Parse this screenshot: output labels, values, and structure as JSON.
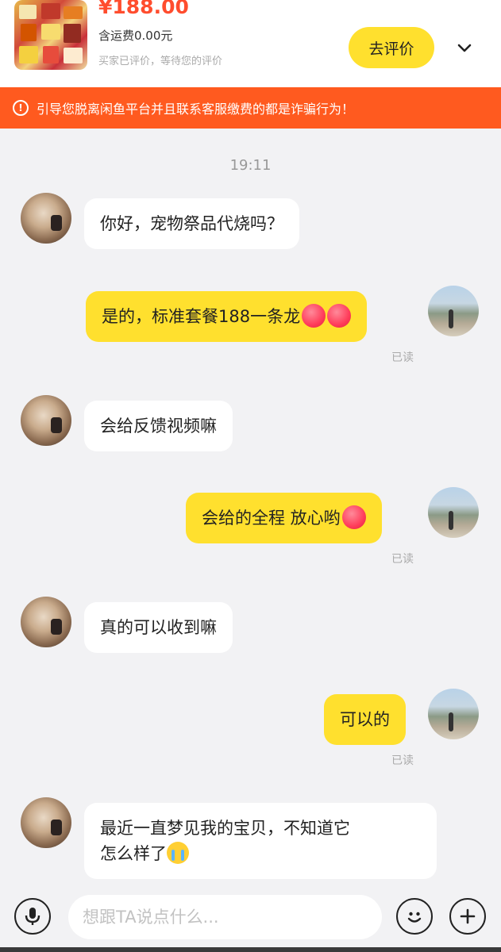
{
  "product": {
    "price": "¥188.00",
    "shipping": "含运费0.00元",
    "review_status": "买家已评价，等待您的评价",
    "review_button": "去评价"
  },
  "warning": {
    "text": "引导您脱离闲鱼平台并且联系客服缴费的都是诈骗行为！"
  },
  "chat": {
    "timestamp": "19:11",
    "messages": [
      {
        "from": "other",
        "text": "你好，宠物祭品代烧吗？"
      },
      {
        "from": "me",
        "text": "是的，标准套餐188一条龙",
        "emoji": "heart-emoji x2",
        "status": "已读"
      },
      {
        "from": "other",
        "text": "会给反馈视频嘛"
      },
      {
        "from": "me",
        "text": "会给的全程 放心哟",
        "emoji": "heart-emoji",
        "status": "已读"
      },
      {
        "from": "other",
        "text": "真的可以收到嘛"
      },
      {
        "from": "me",
        "text": "可以的",
        "status": "已读"
      },
      {
        "from": "other",
        "text_line1": "最近一直梦见我的宝贝，不知道它",
        "text_line2": "怎么样了",
        "emoji": "crying-emoji"
      }
    ]
  },
  "composer": {
    "placeholder": "想跟TA说点什么..."
  },
  "colors": {
    "accent_yellow": "#ffe02e",
    "warning_orange": "#ff5a1f",
    "price_red": "#ff4d2e"
  },
  "icons": [
    "chevron-down-icon",
    "warning-icon",
    "microphone-icon",
    "emoji-icon",
    "plus-icon"
  ]
}
